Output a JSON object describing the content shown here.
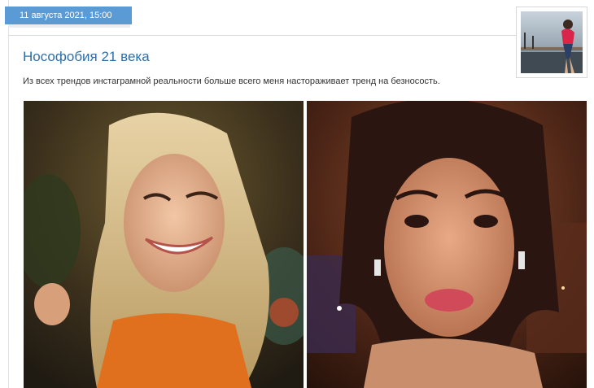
{
  "post": {
    "date": "11 августа 2021, 15:00",
    "title": "Нософобия 21 века",
    "lead": "Из всех трендов инстаграмной реальности больше всего меня настораживает тренд на безносость."
  },
  "images": {
    "avatar": "author-avatar-photo",
    "left": "photo-blonde-woman-smiling",
    "right": "photo-brunette-woman-selfie"
  }
}
